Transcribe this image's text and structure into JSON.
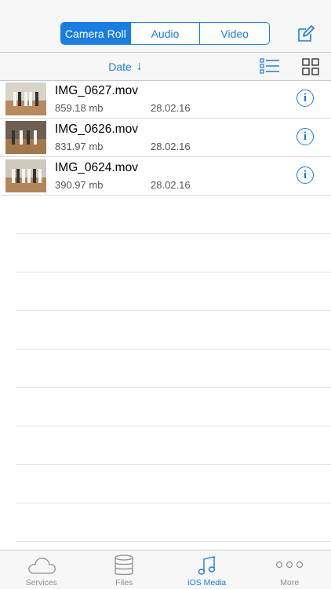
{
  "segments": [
    "Camera Roll",
    "Audio",
    "Video"
  ],
  "active_segment": "Camera Roll",
  "sort": {
    "label": "Date",
    "arrow": "↓"
  },
  "files": [
    {
      "name": "IMG_0627.mov",
      "size": "859.18 mb",
      "date": "28.02.16"
    },
    {
      "name": "IMG_0626.mov",
      "size": "831.97 mb",
      "date": "28.02.16"
    },
    {
      "name": "IMG_0624.mov",
      "size": "390.97 mb",
      "date": "28.02.16"
    }
  ],
  "info_glyph": "i",
  "tabs": [
    {
      "label": "Services",
      "icon": "cloud-icon"
    },
    {
      "label": "Files",
      "icon": "database-icon"
    },
    {
      "label": "iOS Media",
      "icon": "music-note-icon",
      "active": true
    },
    {
      "label": "More",
      "icon": "more-dots-icon"
    }
  ],
  "colors": {
    "accent": "#1a7de3",
    "inactive": "#8e8e93"
  }
}
